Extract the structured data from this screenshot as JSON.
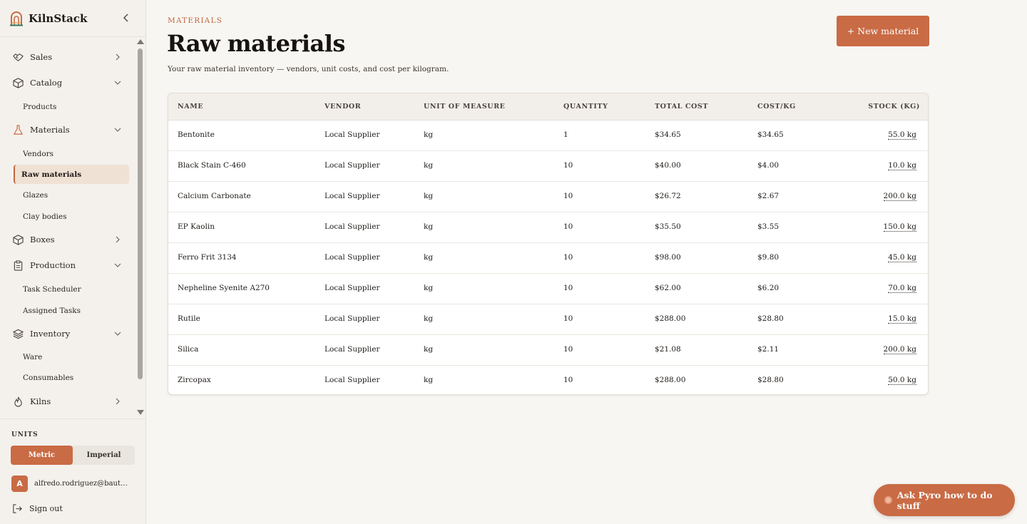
{
  "app": {
    "name": "KilnStack"
  },
  "colors": {
    "accent": "#c96b45",
    "active_bg": "#f0e1d5"
  },
  "sidebar": {
    "groups": [
      {
        "label": "Sales",
        "icon": "handshake-icon",
        "expanded": false
      },
      {
        "label": "Catalog",
        "icon": "box-icon",
        "expanded": true,
        "items": [
          "Products"
        ]
      },
      {
        "label": "Materials",
        "icon": "flask-icon",
        "expanded": true,
        "items": [
          "Vendors",
          "Raw materials",
          "Glazes",
          "Clay bodies"
        ]
      },
      {
        "label": "Boxes",
        "icon": "box-icon",
        "expanded": false
      },
      {
        "label": "Production",
        "icon": "clipboard-icon",
        "expanded": true,
        "items": [
          "Task Scheduler",
          "Assigned Tasks"
        ]
      },
      {
        "label": "Inventory",
        "icon": "layers-icon",
        "expanded": true,
        "items": [
          "Ware",
          "Consumables"
        ]
      },
      {
        "label": "Kilns",
        "icon": "flame-icon",
        "expanded": false
      }
    ],
    "active_item": "Raw materials",
    "units": {
      "label": "UNITS",
      "options": [
        "Metric",
        "Imperial"
      ],
      "selected": "Metric"
    },
    "user": {
      "initial": "A",
      "email": "alfredo.rodriguez@bautonceramics.com"
    },
    "signout_label": "Sign out"
  },
  "page": {
    "eyebrow": "MATERIALS",
    "title": "Raw materials",
    "subtitle": "Your raw material inventory — vendors, unit costs, and cost per kilogram.",
    "new_button": "+ New material"
  },
  "table": {
    "columns": [
      "NAME",
      "VENDOR",
      "UNIT OF MEASURE",
      "QUANTITY",
      "TOTAL COST",
      "COST/KG",
      "STOCK (KG)"
    ],
    "rows": [
      [
        "Bentonite",
        "Local Supplier",
        "kg",
        "1",
        "$34.65",
        "$34.65",
        "55.0 kg"
      ],
      [
        "Black Stain C-460",
        "Local Supplier",
        "kg",
        "10",
        "$40.00",
        "$4.00",
        "10.0 kg"
      ],
      [
        "Calcium Carbonate",
        "Local Supplier",
        "kg",
        "10",
        "$26.72",
        "$2.67",
        "200.0 kg"
      ],
      [
        "EP Kaolin",
        "Local Supplier",
        "kg",
        "10",
        "$35.50",
        "$3.55",
        "150.0 kg"
      ],
      [
        "Ferro Frit 3134",
        "Local Supplier",
        "kg",
        "10",
        "$98.00",
        "$9.80",
        "45.0 kg"
      ],
      [
        "Nepheline Syenite A270",
        "Local Supplier",
        "kg",
        "10",
        "$62.00",
        "$6.20",
        "70.0 kg"
      ],
      [
        "Rutile",
        "Local Supplier",
        "kg",
        "10",
        "$288.00",
        "$28.80",
        "15.0 kg"
      ],
      [
        "Silica",
        "Local Supplier",
        "kg",
        "10",
        "$21.08",
        "$2.11",
        "200.0 kg"
      ],
      [
        "Zircopax",
        "Local Supplier",
        "kg",
        "10",
        "$288.00",
        "$28.80",
        "50.0 kg"
      ]
    ]
  },
  "assistant": {
    "label": "Ask Pyro how to do stuff"
  }
}
